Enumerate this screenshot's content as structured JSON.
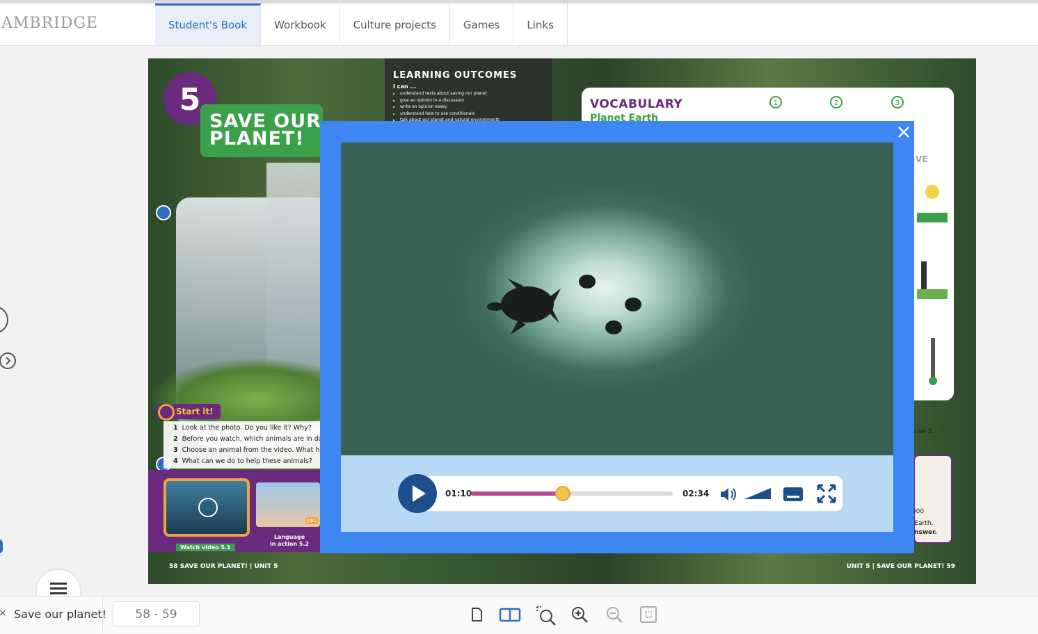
{
  "header": {
    "brand": "AMBRIDGE",
    "tabs": [
      {
        "label": "Student's Book",
        "active": true
      },
      {
        "label": "Workbook",
        "active": false
      },
      {
        "label": "Culture projects",
        "active": false
      },
      {
        "label": "Games",
        "active": false
      },
      {
        "label": "Links",
        "active": false
      }
    ]
  },
  "book": {
    "unit_number": "5",
    "unit_title_line1": "SAVE OUR",
    "unit_title_line2": "PLANET!",
    "learning_outcomes": {
      "title": "LEARNING OUTCOMES",
      "can": "I can ...",
      "items": [
        "understand texts about saving our planet",
        "give an opinion in a discussion",
        "write an opinion essay",
        "understand how to use conditionals",
        "talk about our planet and natural environments"
      ]
    },
    "vocabulary": {
      "title": "VOCABULARY",
      "subtitle": "Planet Earth",
      "numbers": [
        "1",
        "2",
        "3"
      ],
      "partial_word": "VE"
    },
    "right_texts": {
      "exercise": "cise 3.",
      "amount": ",000",
      "line1": "t Earth.",
      "line2": "answer."
    },
    "start_it": {
      "label": "Start it!",
      "questions": [
        {
          "n": "1",
          "text": "Look at the photo. Do you like it? Why?"
        },
        {
          "n": "2",
          "text": "Before you watch, which animals are in dan"
        },
        {
          "n": "3",
          "text": "Choose an animal from the video. What has"
        },
        {
          "n": "4",
          "text": "What can we do to help these animals?"
        }
      ]
    },
    "watch_video_label": "Watch video 5.1",
    "language_label_line1": "Language",
    "language_label_line2": "in action 5.2",
    "page_ref": "p61",
    "footer_left": "58  SAVE OUR PLANET! | UNIT 5",
    "footer_right": "UNIT 5 | SAVE OUR PLANET!  59"
  },
  "video_player": {
    "current_time": "01:10",
    "duration": "02:34",
    "progress_fraction": 0.4545,
    "volume_fraction": 1.0,
    "colors": {
      "frame": "#3e86f0",
      "controls_bg": "#b9d8f6",
      "play_button": "#1d4f8c",
      "progress": "#b8458f",
      "knob": "#f3c24a"
    },
    "icons": [
      "close-icon",
      "play-icon",
      "volume-icon",
      "volume-level-icon",
      "subtitles-icon",
      "fullscreen-icon"
    ]
  },
  "bottombar": {
    "chapter_title": "Save our planet!",
    "page_range": "58 - 59",
    "tools": [
      "single-page-icon",
      "double-page-icon",
      "zoom-area-icon",
      "zoom-in-icon",
      "zoom-out-icon",
      "fit-page-icon"
    ]
  }
}
